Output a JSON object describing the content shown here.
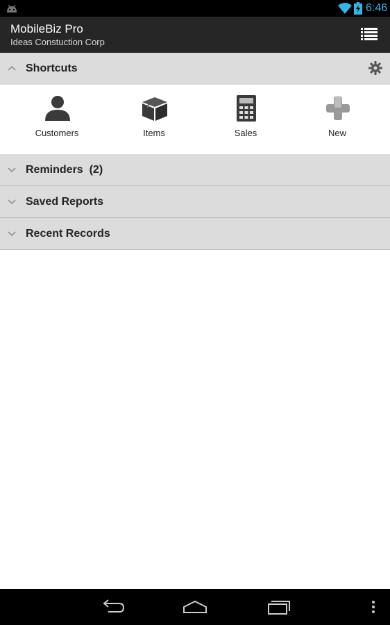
{
  "status_bar": {
    "time": "6:46"
  },
  "action_bar": {
    "title": "MobileBiz Pro",
    "subtitle": "Ideas Constuction Corp"
  },
  "sections": {
    "shortcuts": "Shortcuts",
    "reminders": "Reminders  (2)",
    "saved_reports": "Saved Reports",
    "recent_records": "Recent Records"
  },
  "shortcuts": [
    {
      "label": "Customers",
      "icon": "person-icon"
    },
    {
      "label": "Items",
      "icon": "box-icon"
    },
    {
      "label": "Sales",
      "icon": "calculator-icon"
    },
    {
      "label": "New",
      "icon": "plus-icon"
    }
  ],
  "colors": {
    "accent": "#33b5e5",
    "action_bar": "#262626",
    "section_header": "#dcdcdc"
  }
}
